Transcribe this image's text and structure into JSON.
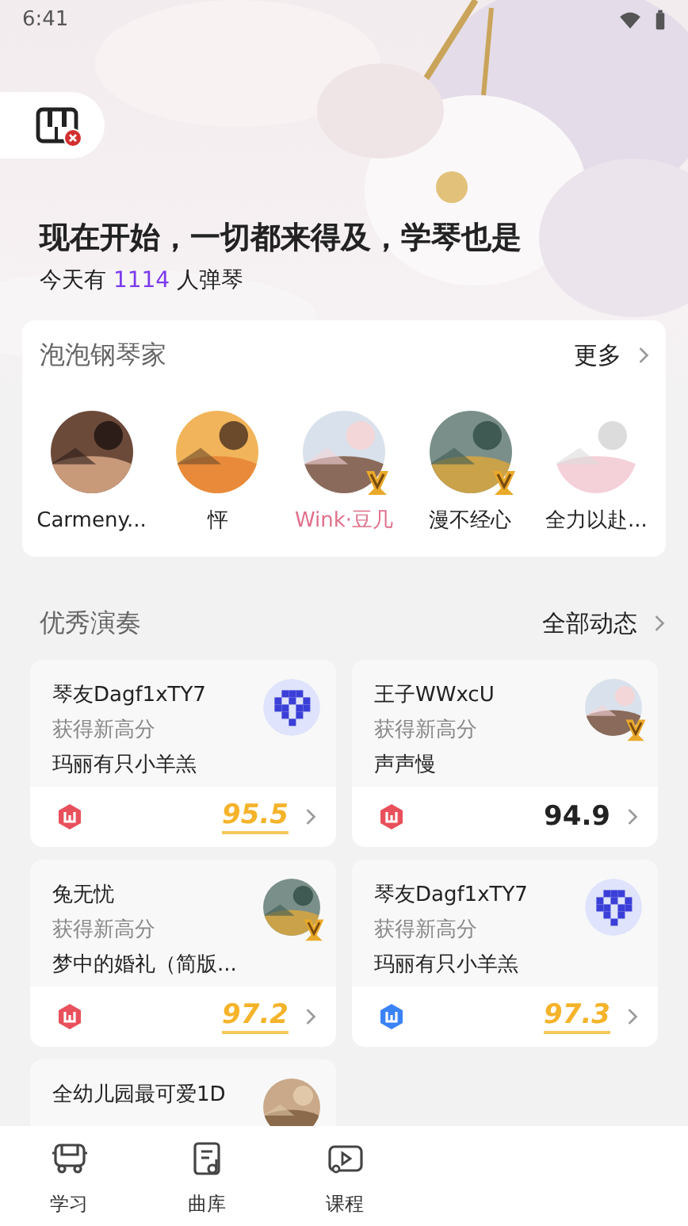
{
  "status_bar": {
    "time": "6:41"
  },
  "hero": {
    "headline": "现在开始，一切都来得及，学琴也是",
    "today_prefix": "今天有",
    "today_count": "1114",
    "today_suffix": "人弹琴",
    "piano_connected": false
  },
  "pianists": {
    "title": "泡泡钢琴家",
    "more": "更多",
    "items": [
      {
        "name": "Carmeny...",
        "verified": false,
        "highlighted": false
      },
      {
        "name": "怦",
        "verified": false,
        "highlighted": false
      },
      {
        "name": "Wink·豆几",
        "verified": true,
        "highlighted": true
      },
      {
        "name": "漫不经心",
        "verified": true,
        "highlighted": false
      },
      {
        "name": "全力以赴...",
        "verified": false,
        "highlighted": false
      }
    ]
  },
  "performances": {
    "title": "优秀演奏",
    "more": "全部动态",
    "cards": [
      {
        "user": "琴友Dagf1xTY7",
        "action": "获得新高分",
        "song": "玛丽有只小羊羔",
        "kind": "pixel",
        "verified": false,
        "color": "#e8505b",
        "score": "95.5",
        "highlighted": true
      },
      {
        "user": "王子WWxcU",
        "action": "获得新高分",
        "song": "声声慢",
        "verified": true,
        "color": "#e8505b",
        "score": "94.9",
        "highlighted": false
      },
      {
        "user": "兔无忧",
        "action": "获得新高分",
        "song": "梦中的婚礼（简版...",
        "verified": true,
        "color": "#e8505b",
        "score": "97.2",
        "highlighted": true
      },
      {
        "user": "琴友Dagf1xTY7",
        "action": "获得新高分",
        "song": "玛丽有只小羊羔",
        "kind": "pixel",
        "verified": false,
        "color": "#3b82f6",
        "score": "97.3",
        "highlighted": true
      },
      {
        "user": "全幼儿园最可爱1D",
        "verified": false
      }
    ]
  },
  "tab_bar": [
    {
      "label": "学习",
      "kind": "bus"
    },
    {
      "label": "曲库",
      "kind": "sheet"
    },
    {
      "label": "课程",
      "kind": "video"
    }
  ]
}
